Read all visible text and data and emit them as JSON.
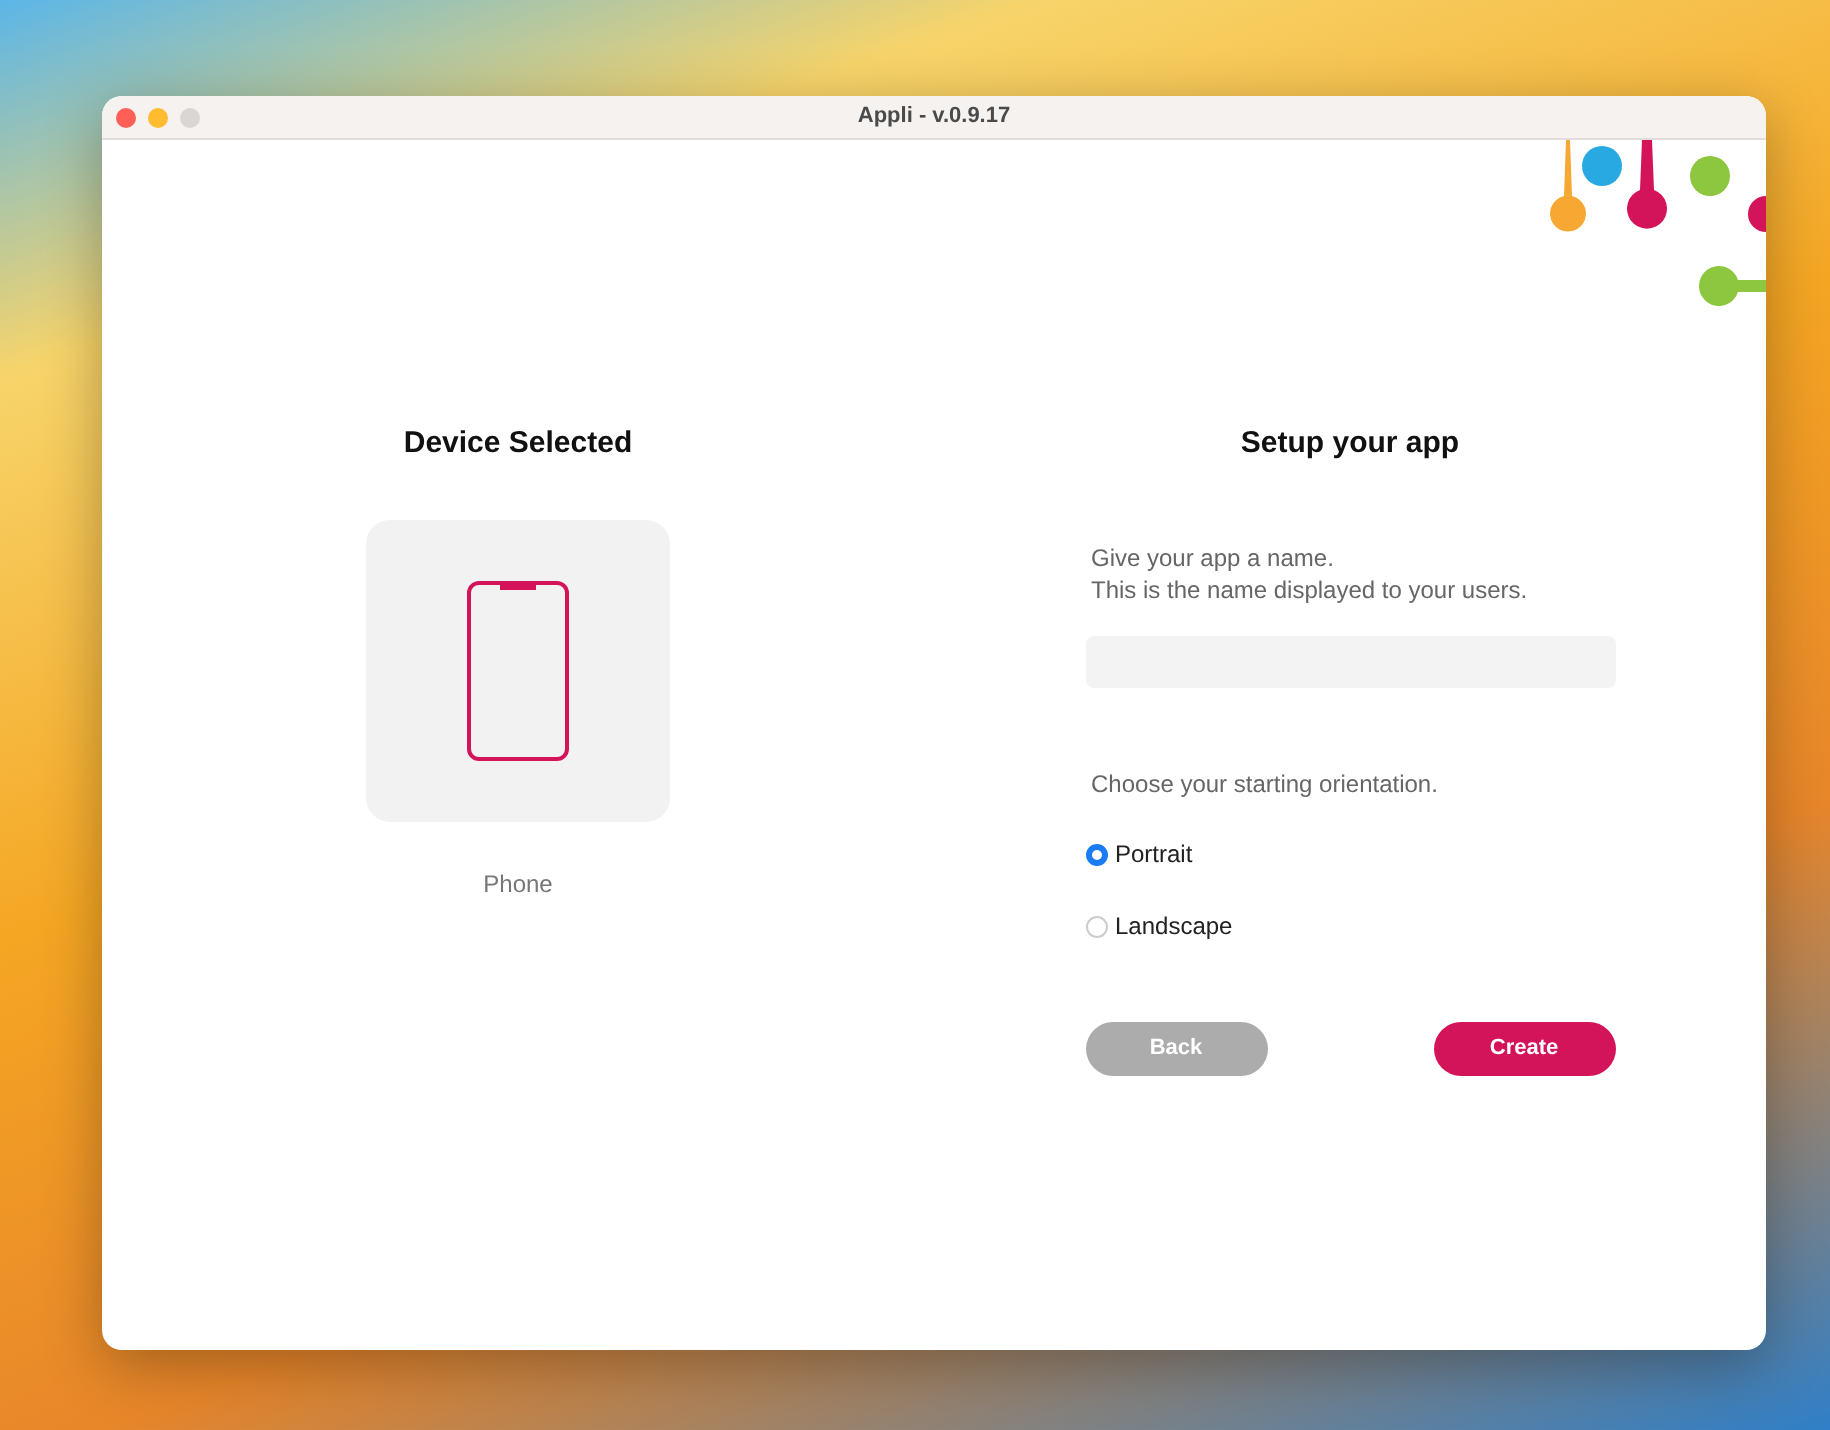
{
  "window": {
    "title": "Appli - v.0.9.17"
  },
  "device": {
    "heading": "Device Selected",
    "label": "Phone"
  },
  "setup": {
    "heading": "Setup your app",
    "name_hint": [
      "Give your app a name.",
      "This is the name displayed to your users."
    ],
    "orientation_prompt": "Choose your starting orientation.",
    "orientations": [
      {
        "label": "Portrait",
        "selected": true
      },
      {
        "label": "Landscape",
        "selected": false
      }
    ],
    "buttons": [
      {
        "label": "Back",
        "disabled": true
      },
      {
        "label": "Create",
        "disabled": false
      }
    ]
  }
}
